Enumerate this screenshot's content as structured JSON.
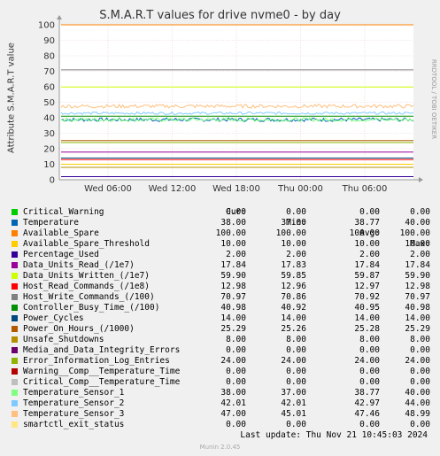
{
  "chart_data": {
    "type": "line",
    "title": "S.M.A.R.T values for drive nvme0 - by day",
    "ylabel": "Attribute S.M.A.R.T value",
    "ylim": [
      0,
      100
    ],
    "yticks": [
      "0",
      "10",
      "20",
      "30",
      "40",
      "50",
      "60",
      "70",
      "80",
      "90",
      "100"
    ],
    "xticks": [
      "Wed 06:00",
      "Wed 12:00",
      "Wed 18:00",
      "Thu 00:00",
      "Thu 06:00"
    ],
    "credit": "RRDTOOL / TOBI OETIKER",
    "columns": [
      "Cur:",
      "Min:",
      "Avg:",
      "Max:"
    ],
    "series": [
      {
        "name": "Critical_Warning",
        "color": "#00cc00",
        "cur": "0.00",
        "min": "0.00",
        "avg": "0.00",
        "max": "0.00",
        "level": 0
      },
      {
        "name": "Temperature",
        "color": "#0066b3",
        "cur": "38.00",
        "min": "37.00",
        "avg": "38.77",
        "max": "40.00",
        "level": 38.77,
        "noise": 1.2
      },
      {
        "name": "Available_Spare",
        "color": "#ff8000",
        "cur": "100.00",
        "min": "100.00",
        "avg": "100.00",
        "max": "100.00",
        "level": 100
      },
      {
        "name": "Available_Spare_Threshold",
        "color": "#ffcc00",
        "cur": "10.00",
        "min": "10.00",
        "avg": "10.00",
        "max": "10.00",
        "level": 10
      },
      {
        "name": "Percentage_Used",
        "color": "#330099",
        "cur": "2.00",
        "min": "2.00",
        "avg": "2.00",
        "max": "2.00",
        "level": 2
      },
      {
        "name": "Data_Units_Read_(/1e7)",
        "color": "#990099",
        "cur": "17.84",
        "min": "17.83",
        "avg": "17.84",
        "max": "17.84",
        "level": 17.84
      },
      {
        "name": "Data_Units_Written_(/1e7)",
        "color": "#ccff00",
        "cur": "59.90",
        "min": "59.85",
        "avg": "59.87",
        "max": "59.90",
        "level": 59.87
      },
      {
        "name": "Host_Read_Commands_(/1e8)",
        "color": "#ff0000",
        "cur": "12.98",
        "min": "12.96",
        "avg": "12.97",
        "max": "12.98",
        "level": 12.97
      },
      {
        "name": "Host_Write_Commands_(/100)",
        "color": "#808080",
        "cur": "70.97",
        "min": "70.86",
        "avg": "70.92",
        "max": "70.97",
        "level": 70.92
      },
      {
        "name": "Controller_Busy_Time_(/100)",
        "color": "#008f00",
        "cur": "40.98",
        "min": "40.92",
        "avg": "40.95",
        "max": "40.98",
        "level": 40.95
      },
      {
        "name": "Power_Cycles",
        "color": "#00487d",
        "cur": "14.00",
        "min": "14.00",
        "avg": "14.00",
        "max": "14.00",
        "level": 14
      },
      {
        "name": "Power_On_Hours_(/1000)",
        "color": "#b35a00",
        "cur": "25.29",
        "min": "25.26",
        "avg": "25.28",
        "max": "25.29",
        "level": 25.28
      },
      {
        "name": "Unsafe_Shutdowns",
        "color": "#b38f00",
        "cur": "8.00",
        "min": "8.00",
        "avg": "8.00",
        "max": "8.00",
        "level": 8
      },
      {
        "name": "Media_and_Data_Integrity_Errors",
        "color": "#6b006b",
        "cur": "0.00",
        "min": "0.00",
        "avg": "0.00",
        "max": "0.00",
        "level": 0
      },
      {
        "name": "Error_Information_Log_Entries",
        "color": "#8fb300",
        "cur": "24.00",
        "min": "24.00",
        "avg": "24.00",
        "max": "24.00",
        "level": 24
      },
      {
        "name": "Warning__Comp__Temperature_Time",
        "color": "#b30000",
        "cur": "0.00",
        "min": "0.00",
        "avg": "0.00",
        "max": "0.00",
        "level": 0
      },
      {
        "name": "Critical_Comp__Temperature_Time",
        "color": "#bebebe",
        "cur": "0.00",
        "min": "0.00",
        "avg": "0.00",
        "max": "0.00",
        "level": 0
      },
      {
        "name": "Temperature_Sensor_1",
        "color": "#80ff80",
        "cur": "38.00",
        "min": "37.00",
        "avg": "38.77",
        "max": "40.00",
        "level": 38.77,
        "noise": 1.2
      },
      {
        "name": "Temperature_Sensor_2",
        "color": "#80c9ff",
        "cur": "42.01",
        "min": "42.01",
        "avg": "42.97",
        "max": "44.00",
        "level": 42.97,
        "noise": 0.8
      },
      {
        "name": "Temperature_Sensor_3",
        "color": "#ffc080",
        "cur": "47.00",
        "min": "45.01",
        "avg": "47.46",
        "max": "48.99",
        "level": 47.46,
        "noise": 1.2
      },
      {
        "name": "smartctl_exit_status",
        "color": "#ffe680",
        "cur": "0.00",
        "min": "0.00",
        "avg": "0.00",
        "max": "0.00",
        "level": 0
      }
    ]
  },
  "footer": {
    "last_update": "Last update: Thu Nov 21 10:45:03 2024",
    "version": "Munin 2.0.45"
  }
}
